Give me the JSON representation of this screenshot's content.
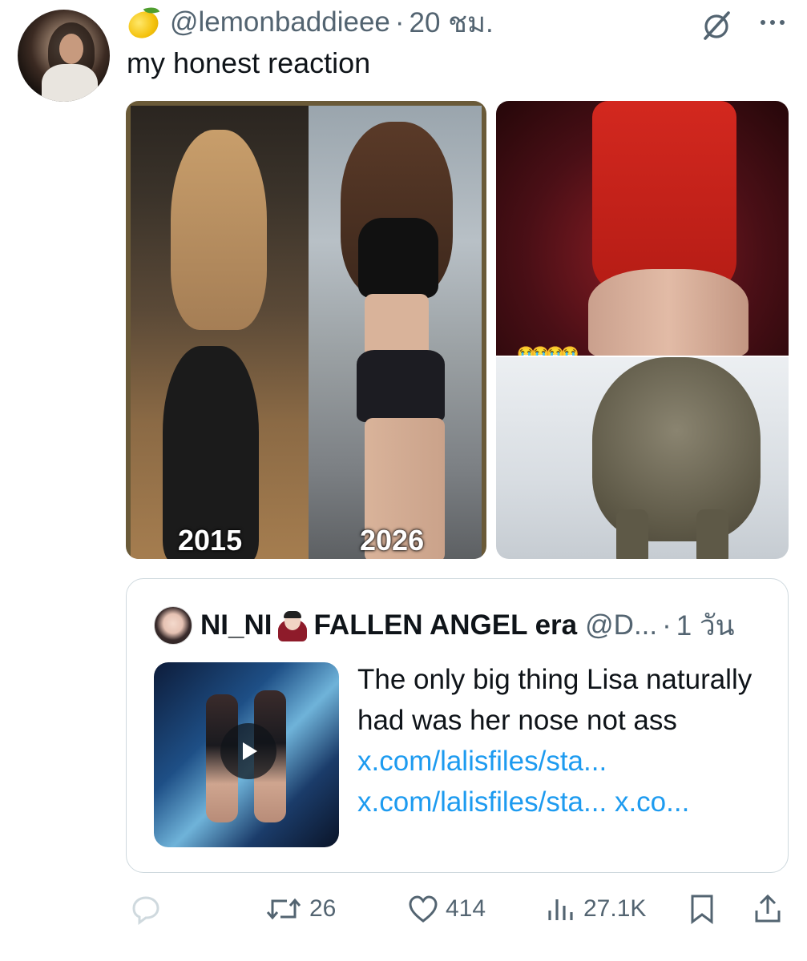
{
  "tweet": {
    "handle": "@lemonbaddieee",
    "separator": "·",
    "time": "20 ชม.",
    "text": "my honest reaction"
  },
  "media": {
    "label_left": "2015",
    "label_right": "2026",
    "emoji_overlay": "😭😭😭😭"
  },
  "quote": {
    "name": "NI_NI",
    "name_suffix": "FALLEN ANGEL era",
    "handle": "@D...",
    "separator": "·",
    "time": "1 วัน",
    "text": "The only big thing Lisa naturally had was her nose not ass",
    "link1": "x.com/lalisfiles/sta...",
    "link2": "x.com/lalisfiles/sta...",
    "link3": "x.co..."
  },
  "actions": {
    "retweets": "26",
    "likes": "414",
    "views": "27.1K"
  },
  "icons": {
    "reply": "reply-icon",
    "retweet": "retweet-icon",
    "like": "heart-icon",
    "views": "views-icon",
    "bookmark": "bookmark-icon",
    "share": "share-icon",
    "grok": "grok-icon",
    "more": "more-icon"
  },
  "colors": {
    "link": "#1d9bf0",
    "secondary_text": "#536471"
  }
}
